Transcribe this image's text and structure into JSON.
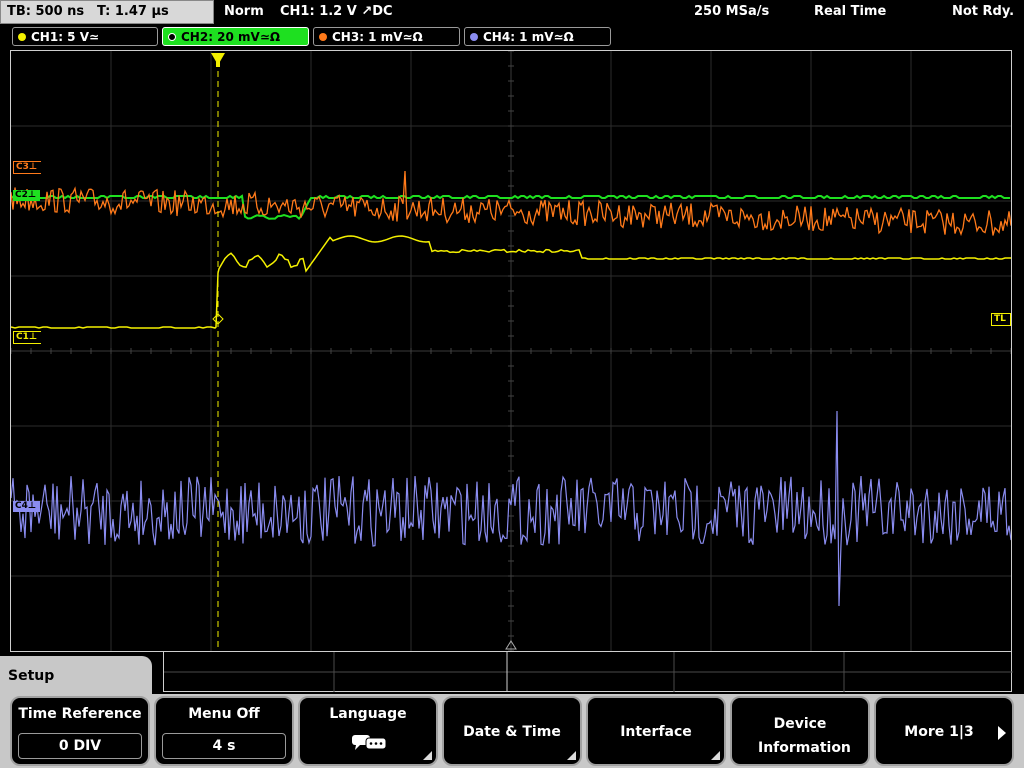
{
  "top": {
    "tb": "TB: 500 ns",
    "trig_time": "T: 1.47 µs",
    "mode": "Norm",
    "trigger": "CH1: 1.2 V ↗DC",
    "sample_rate": "250 MSa/s",
    "acq_mode": "Real Time",
    "state": "Not Rdy."
  },
  "channels": [
    {
      "label": "CH1: 5 V≃",
      "color": "#f4f000"
    },
    {
      "label": "CH2: 20 mV≃Ω",
      "color": "#1ee020"
    },
    {
      "label": "CH3: 1 mV≃Ω",
      "color": "#ff7a1a"
    },
    {
      "label": "CH4: 1 mV≃Ω",
      "color": "#8a8cf0"
    }
  ],
  "markers": {
    "c3": "C3",
    "c1": "C1",
    "c2": "C2",
    "c4": "C4",
    "tl": "TL"
  },
  "menu": {
    "title": "Setup",
    "keys": [
      {
        "label": "Time Reference",
        "value": "0 DIV"
      },
      {
        "label": "Menu Off",
        "value": "4 s"
      },
      {
        "label": "Language",
        "icon": "speech-bubbles-icon"
      },
      {
        "label": "Date & Time"
      },
      {
        "label": "Interface"
      },
      {
        "label": "Device Information"
      },
      {
        "label": "More 1|3"
      }
    ]
  }
}
